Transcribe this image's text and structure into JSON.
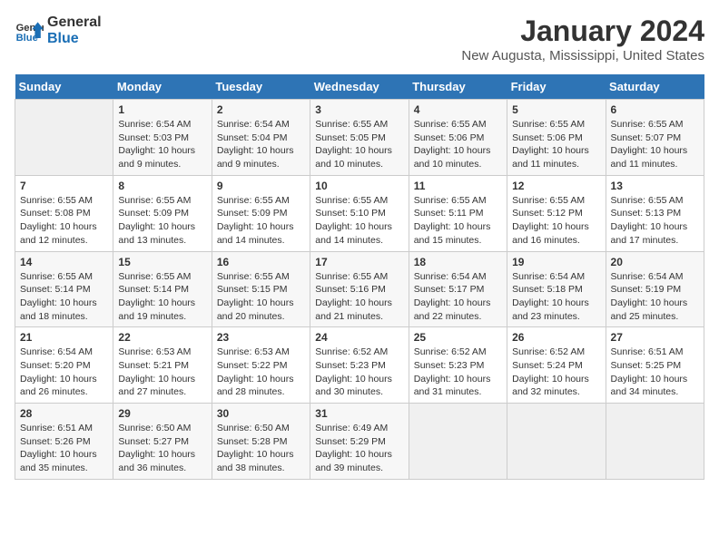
{
  "header": {
    "logo_line1": "General",
    "logo_line2": "Blue",
    "title": "January 2024",
    "subtitle": "New Augusta, Mississippi, United States"
  },
  "days_of_week": [
    "Sunday",
    "Monday",
    "Tuesday",
    "Wednesday",
    "Thursday",
    "Friday",
    "Saturday"
  ],
  "weeks": [
    [
      {
        "day": "",
        "sunrise": "",
        "sunset": "",
        "daylight": "",
        "empty": true
      },
      {
        "day": "1",
        "sunrise": "Sunrise: 6:54 AM",
        "sunset": "Sunset: 5:03 PM",
        "daylight": "Daylight: 10 hours and 9 minutes."
      },
      {
        "day": "2",
        "sunrise": "Sunrise: 6:54 AM",
        "sunset": "Sunset: 5:04 PM",
        "daylight": "Daylight: 10 hours and 9 minutes."
      },
      {
        "day": "3",
        "sunrise": "Sunrise: 6:55 AM",
        "sunset": "Sunset: 5:05 PM",
        "daylight": "Daylight: 10 hours and 10 minutes."
      },
      {
        "day": "4",
        "sunrise": "Sunrise: 6:55 AM",
        "sunset": "Sunset: 5:06 PM",
        "daylight": "Daylight: 10 hours and 10 minutes."
      },
      {
        "day": "5",
        "sunrise": "Sunrise: 6:55 AM",
        "sunset": "Sunset: 5:06 PM",
        "daylight": "Daylight: 10 hours and 11 minutes."
      },
      {
        "day": "6",
        "sunrise": "Sunrise: 6:55 AM",
        "sunset": "Sunset: 5:07 PM",
        "daylight": "Daylight: 10 hours and 11 minutes."
      }
    ],
    [
      {
        "day": "7",
        "sunrise": "Sunrise: 6:55 AM",
        "sunset": "Sunset: 5:08 PM",
        "daylight": "Daylight: 10 hours and 12 minutes."
      },
      {
        "day": "8",
        "sunrise": "Sunrise: 6:55 AM",
        "sunset": "Sunset: 5:09 PM",
        "daylight": "Daylight: 10 hours and 13 minutes."
      },
      {
        "day": "9",
        "sunrise": "Sunrise: 6:55 AM",
        "sunset": "Sunset: 5:09 PM",
        "daylight": "Daylight: 10 hours and 14 minutes."
      },
      {
        "day": "10",
        "sunrise": "Sunrise: 6:55 AM",
        "sunset": "Sunset: 5:10 PM",
        "daylight": "Daylight: 10 hours and 14 minutes."
      },
      {
        "day": "11",
        "sunrise": "Sunrise: 6:55 AM",
        "sunset": "Sunset: 5:11 PM",
        "daylight": "Daylight: 10 hours and 15 minutes."
      },
      {
        "day": "12",
        "sunrise": "Sunrise: 6:55 AM",
        "sunset": "Sunset: 5:12 PM",
        "daylight": "Daylight: 10 hours and 16 minutes."
      },
      {
        "day": "13",
        "sunrise": "Sunrise: 6:55 AM",
        "sunset": "Sunset: 5:13 PM",
        "daylight": "Daylight: 10 hours and 17 minutes."
      }
    ],
    [
      {
        "day": "14",
        "sunrise": "Sunrise: 6:55 AM",
        "sunset": "Sunset: 5:14 PM",
        "daylight": "Daylight: 10 hours and 18 minutes."
      },
      {
        "day": "15",
        "sunrise": "Sunrise: 6:55 AM",
        "sunset": "Sunset: 5:14 PM",
        "daylight": "Daylight: 10 hours and 19 minutes."
      },
      {
        "day": "16",
        "sunrise": "Sunrise: 6:55 AM",
        "sunset": "Sunset: 5:15 PM",
        "daylight": "Daylight: 10 hours and 20 minutes."
      },
      {
        "day": "17",
        "sunrise": "Sunrise: 6:55 AM",
        "sunset": "Sunset: 5:16 PM",
        "daylight": "Daylight: 10 hours and 21 minutes."
      },
      {
        "day": "18",
        "sunrise": "Sunrise: 6:54 AM",
        "sunset": "Sunset: 5:17 PM",
        "daylight": "Daylight: 10 hours and 22 minutes."
      },
      {
        "day": "19",
        "sunrise": "Sunrise: 6:54 AM",
        "sunset": "Sunset: 5:18 PM",
        "daylight": "Daylight: 10 hours and 23 minutes."
      },
      {
        "day": "20",
        "sunrise": "Sunrise: 6:54 AM",
        "sunset": "Sunset: 5:19 PM",
        "daylight": "Daylight: 10 hours and 25 minutes."
      }
    ],
    [
      {
        "day": "21",
        "sunrise": "Sunrise: 6:54 AM",
        "sunset": "Sunset: 5:20 PM",
        "daylight": "Daylight: 10 hours and 26 minutes."
      },
      {
        "day": "22",
        "sunrise": "Sunrise: 6:53 AM",
        "sunset": "Sunset: 5:21 PM",
        "daylight": "Daylight: 10 hours and 27 minutes."
      },
      {
        "day": "23",
        "sunrise": "Sunrise: 6:53 AM",
        "sunset": "Sunset: 5:22 PM",
        "daylight": "Daylight: 10 hours and 28 minutes."
      },
      {
        "day": "24",
        "sunrise": "Sunrise: 6:52 AM",
        "sunset": "Sunset: 5:23 PM",
        "daylight": "Daylight: 10 hours and 30 minutes."
      },
      {
        "day": "25",
        "sunrise": "Sunrise: 6:52 AM",
        "sunset": "Sunset: 5:23 PM",
        "daylight": "Daylight: 10 hours and 31 minutes."
      },
      {
        "day": "26",
        "sunrise": "Sunrise: 6:52 AM",
        "sunset": "Sunset: 5:24 PM",
        "daylight": "Daylight: 10 hours and 32 minutes."
      },
      {
        "day": "27",
        "sunrise": "Sunrise: 6:51 AM",
        "sunset": "Sunset: 5:25 PM",
        "daylight": "Daylight: 10 hours and 34 minutes."
      }
    ],
    [
      {
        "day": "28",
        "sunrise": "Sunrise: 6:51 AM",
        "sunset": "Sunset: 5:26 PM",
        "daylight": "Daylight: 10 hours and 35 minutes."
      },
      {
        "day": "29",
        "sunrise": "Sunrise: 6:50 AM",
        "sunset": "Sunset: 5:27 PM",
        "daylight": "Daylight: 10 hours and 36 minutes."
      },
      {
        "day": "30",
        "sunrise": "Sunrise: 6:50 AM",
        "sunset": "Sunset: 5:28 PM",
        "daylight": "Daylight: 10 hours and 38 minutes."
      },
      {
        "day": "31",
        "sunrise": "Sunrise: 6:49 AM",
        "sunset": "Sunset: 5:29 PM",
        "daylight": "Daylight: 10 hours and 39 minutes."
      },
      {
        "day": "",
        "sunrise": "",
        "sunset": "",
        "daylight": "",
        "empty": true
      },
      {
        "day": "",
        "sunrise": "",
        "sunset": "",
        "daylight": "",
        "empty": true
      },
      {
        "day": "",
        "sunrise": "",
        "sunset": "",
        "daylight": "",
        "empty": true
      }
    ]
  ]
}
